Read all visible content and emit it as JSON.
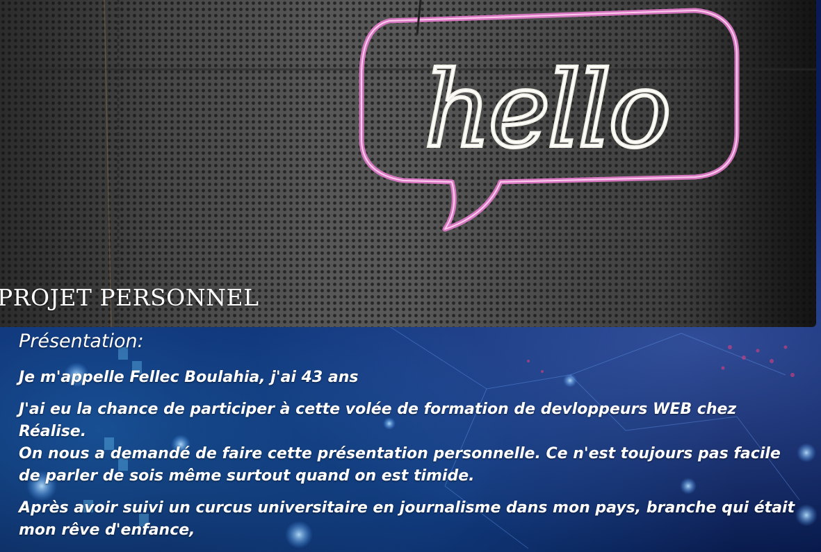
{
  "hero": {
    "title": "PROJET PERSONNEL",
    "image_alt": "hello-neon-sign",
    "neon_text": "hello"
  },
  "presentation": {
    "heading": "Présentation:",
    "paragraphs": [
      "Je m'appelle Fellec Boulahia, j'ai 43 ans",
      "J'ai eu la chance de participer à cette volée de formation de devloppeurs WEB chez Réalise.",
      "On nous a demandé de faire cette présentation personnelle. Ce n'est toujours pas facile de parler de sois même surtout quand on est timide.",
      "Après avoir suivi un curcus universitaire en journalisme dans mon pays, branche qui était mon rêve d'enfance,"
    ]
  },
  "colors": {
    "text": "#ffffff",
    "background_accent": "#0b1a4a",
    "neon_pink": "#e07ac8",
    "neon_white": "#f0f0e6"
  }
}
